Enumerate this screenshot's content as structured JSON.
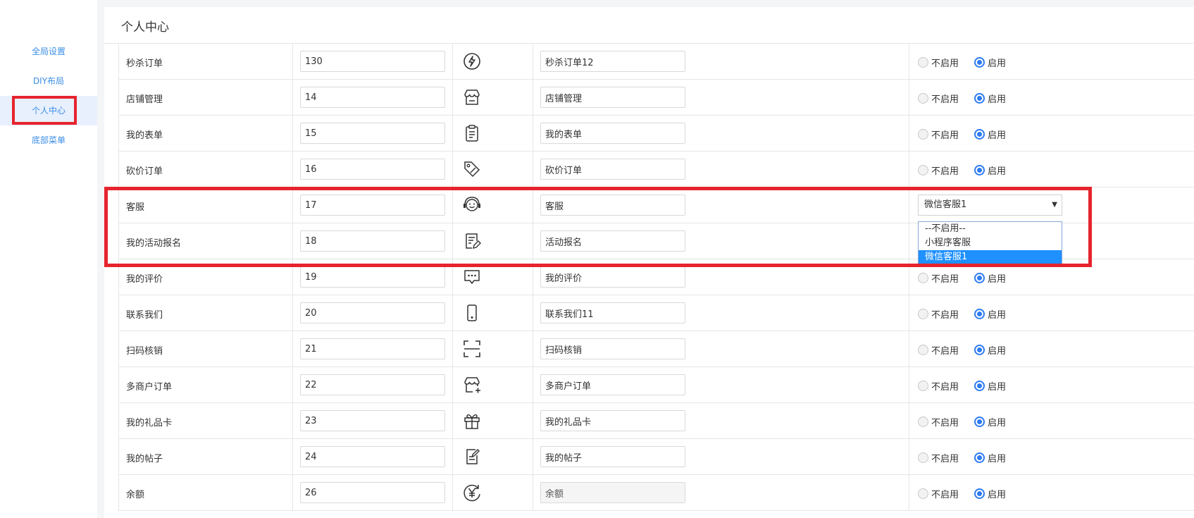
{
  "sidebar": {
    "items": [
      {
        "label": "全局设置",
        "active": false
      },
      {
        "label": "DIY布局",
        "active": false
      },
      {
        "label": "个人中心",
        "active": true
      },
      {
        "label": "底部菜单",
        "active": false
      }
    ]
  },
  "main": {
    "title": "个人中心"
  },
  "status_labels": {
    "off": "不启用",
    "on": "启用"
  },
  "rows": [
    {
      "name": "秒杀订单",
      "sort": "130",
      "icon": "lightning-icon",
      "text": "秒杀订单12",
      "status": "on"
    },
    {
      "name": "店铺管理",
      "sort": "14",
      "icon": "store-icon",
      "text": "店铺管理",
      "status": "on"
    },
    {
      "name": "我的表单",
      "sort": "15",
      "icon": "clipboard-icon",
      "text": "我的表单",
      "status": "on"
    },
    {
      "name": "砍价订单",
      "sort": "16",
      "icon": "tag-discount-icon",
      "text": "砍价订单",
      "status": "on"
    },
    {
      "name": "客服",
      "sort": "17",
      "icon": "customer-service-icon",
      "text": "客服",
      "status": "select"
    },
    {
      "name": "我的活动报名",
      "sort": "18",
      "icon": "note-edit-icon",
      "text": "活动报名",
      "status": "none"
    },
    {
      "name": "我的评价",
      "sort": "19",
      "icon": "chat-bubble-icon",
      "text": "我的评价",
      "status": "on"
    },
    {
      "name": "联系我们",
      "sort": "20",
      "icon": "phone-icon",
      "text": "联系我们11",
      "status": "on"
    },
    {
      "name": "扫码核销",
      "sort": "21",
      "icon": "scan-icon",
      "text": "扫码核销",
      "status": "on"
    },
    {
      "name": "多商户订单",
      "sort": "22",
      "icon": "store-add-icon",
      "text": "多商户订单",
      "status": "on"
    },
    {
      "name": "我的礼品卡",
      "sort": "23",
      "icon": "gift-icon",
      "text": "我的礼品卡",
      "status": "on"
    },
    {
      "name": "我的帖子",
      "sort": "24",
      "icon": "post-edit-icon",
      "text": "我的帖子",
      "status": "on"
    },
    {
      "name": "余额",
      "sort": "26",
      "icon": "yuan-balance-icon",
      "text": "余额",
      "status": "on",
      "text_disabled": true
    }
  ],
  "service_select": {
    "value": "微信客服1",
    "options": [
      "--不启用--",
      "小程序客服",
      "微信客服1"
    ],
    "selected_index": 2
  },
  "colors": {
    "accent": "#2d7bf4",
    "highlight": "#e6242e",
    "link": "#3a8ee6"
  }
}
